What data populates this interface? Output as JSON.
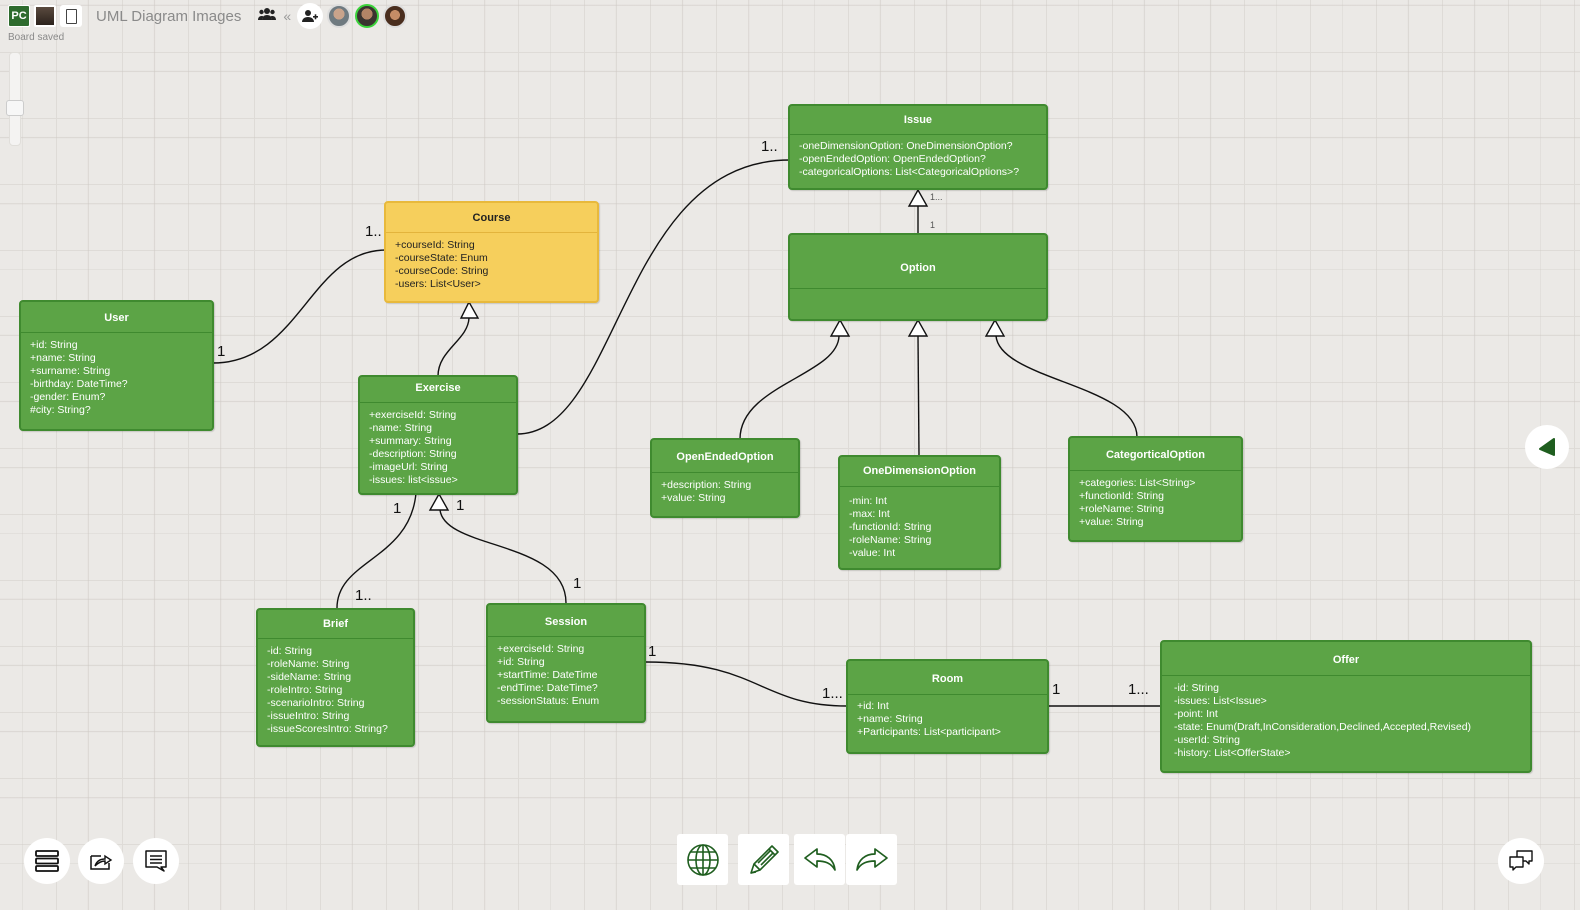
{
  "header": {
    "user_initials": "PC",
    "board_title": "UML Diagram Images",
    "status": "Board saved",
    "icons": {
      "team": "users-icon",
      "collapse": "double-chevron-left-icon",
      "add_user": "add-user-icon"
    }
  },
  "classes": {
    "user": {
      "name": "User",
      "attrs": [
        "+id: String",
        "+name: String",
        "+surname: String",
        "-birthday: DateTime?",
        "-gender: Enum?",
        "#city: String?"
      ]
    },
    "course": {
      "name": "Course",
      "attrs": [
        "+courseId: String",
        "-courseState: Enum",
        "-courseCode: String",
        "-users: List<User>"
      ]
    },
    "exercise": {
      "name": "Exercise",
      "attrs": [
        "+exerciseId: String",
        "-name: String",
        "+summary: String",
        "-description: String",
        "-imageUrl: String",
        "-issues: list<issue>"
      ]
    },
    "issue": {
      "name": "Issue",
      "attrs": [
        "-oneDimensionOption: OneDimensionOption?",
        "-openEndedOption: OpenEndedOption?",
        "-categoricalOptions: List<CategoricalOptions>?"
      ]
    },
    "option": {
      "name": "Option",
      "attrs": []
    },
    "open_ended_option": {
      "name": "OpenEndedOption",
      "attrs": [
        "+description: String",
        "+value: String"
      ]
    },
    "one_dimension_option": {
      "name": "OneDimensionOption",
      "attrs": [
        "-min: Int",
        "-max: Int",
        "-functionId: String",
        "-roleName: String",
        "-value: Int"
      ]
    },
    "categorical_option": {
      "name": "CategorticalOption",
      "attrs": [
        "+categories: List<String>",
        "+functionId: String",
        "+roleName: String",
        "+value: String"
      ]
    },
    "brief": {
      "name": "Brief",
      "attrs": [
        "-id: String",
        "-roleName: String",
        "-sideName: String",
        "-roleIntro: String",
        "-scenarioIntro: String",
        "-issueIntro: String",
        "-issueScoresIntro: String?"
      ]
    },
    "session": {
      "name": "Session",
      "attrs": [
        "+exerciseId: String",
        "+id: String",
        "+startTime: DateTime",
        "-endTime: DateTime?",
        "-sessionStatus: Enum"
      ]
    },
    "room": {
      "name": "Room",
      "attrs": [
        "+id: Int",
        "+name: String",
        "+Participants: List<participant>"
      ]
    },
    "offer": {
      "name": "Offer",
      "attrs": [
        "-id: String",
        "-issues: List<Issue>",
        "-point: Int",
        "-state: Enum(Draft,InConsideration,Declined,Accepted,Revised)",
        "-userId: String",
        "-history: List<OfferState>"
      ]
    }
  },
  "multiplicities": {
    "user_course_user": "1",
    "user_course_course": "1..",
    "exercise_issue": "1..",
    "issue_option_top": "1...",
    "issue_option_bottom": "1",
    "exercise_brief_top": "1",
    "exercise_brief_bottom": "1..",
    "exercise_session_top": "1",
    "exercise_session_bottom": "1",
    "session_room_session": "1",
    "session_room_room": "1...",
    "room_offer_room": "1",
    "room_offer_offer": "1..."
  },
  "colors": {
    "class_fill": "#5ca446",
    "class_border": "#3f8a2f",
    "highlight_fill": "#f6cf5c",
    "toolbar_icon": "#1f5e1f"
  },
  "toolbar": {
    "left": [
      "menu-icon",
      "share-board-icon",
      "comment-icon"
    ],
    "center": [
      "globe-icon",
      "pencil-icon",
      "undo-icon",
      "redo-icon"
    ],
    "right": [
      "chat-icon"
    ],
    "side_panel": "collapse-panel-icon"
  }
}
